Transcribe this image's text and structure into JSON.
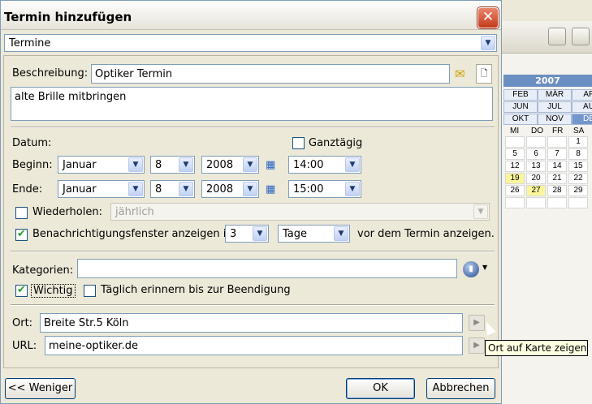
{
  "dialog": {
    "title": "Termin hinzufügen",
    "calendar_select": "Termine"
  },
  "form": {
    "description_label": "Beschreibung:",
    "description_value": "Optiker Termin",
    "notes_value": "alte Brille mitbringen",
    "date_label": "Datum:",
    "allday_label": "Ganztägig",
    "allday_checked": false,
    "begin_label": "Beginn:",
    "begin_month": "Januar",
    "begin_day": "8",
    "begin_year": "2008",
    "begin_time": "14:00",
    "end_label": "Ende:",
    "end_month": "Januar",
    "end_day": "8",
    "end_year": "2008",
    "end_time": "15:00",
    "repeat_label": "Wiederholen:",
    "repeat_checked": false,
    "repeat_value": "jährlich",
    "notify_label": "Benachrichtigungsfenster anzeigen in",
    "notify_checked": true,
    "notify_amount": "3",
    "notify_unit": "Tage",
    "notify_suffix": "vor dem Termin anzeigen.",
    "categories_label": "Kategorien:",
    "categories_value": "",
    "important_label": "Wichtig",
    "important_checked": true,
    "daily_reminder_label": "Täglich erinnern bis zur Beendigung",
    "daily_reminder_checked": false,
    "location_label": "Ort:",
    "location_value": "Breite Str.5 Köln",
    "url_label": "URL:",
    "url_value": "meine-optiker.de"
  },
  "buttons": {
    "less": "<< Weniger",
    "ok": "OK",
    "cancel": "Abbrechen"
  },
  "tooltip": "Ort auf Karte zeigen",
  "background_calendar": {
    "year": "2007",
    "months": [
      "FEB",
      "MÄR",
      "AP",
      "JUN",
      "JUL",
      "AU",
      "OKT",
      "NOV",
      "DE"
    ],
    "weekdays": [
      "MI",
      "DO",
      "FR",
      "SA"
    ],
    "rows": [
      [
        "",
        "",
        "",
        "1"
      ],
      [
        "5",
        "6",
        "7",
        "8"
      ],
      [
        "12",
        "13",
        "14",
        "15"
      ],
      [
        "19",
        "20",
        "21",
        "22"
      ],
      [
        "26",
        "27",
        "28",
        "29"
      ],
      [
        "",
        "",
        "",
        ""
      ]
    ],
    "highlight_color": "#fbf59c"
  }
}
